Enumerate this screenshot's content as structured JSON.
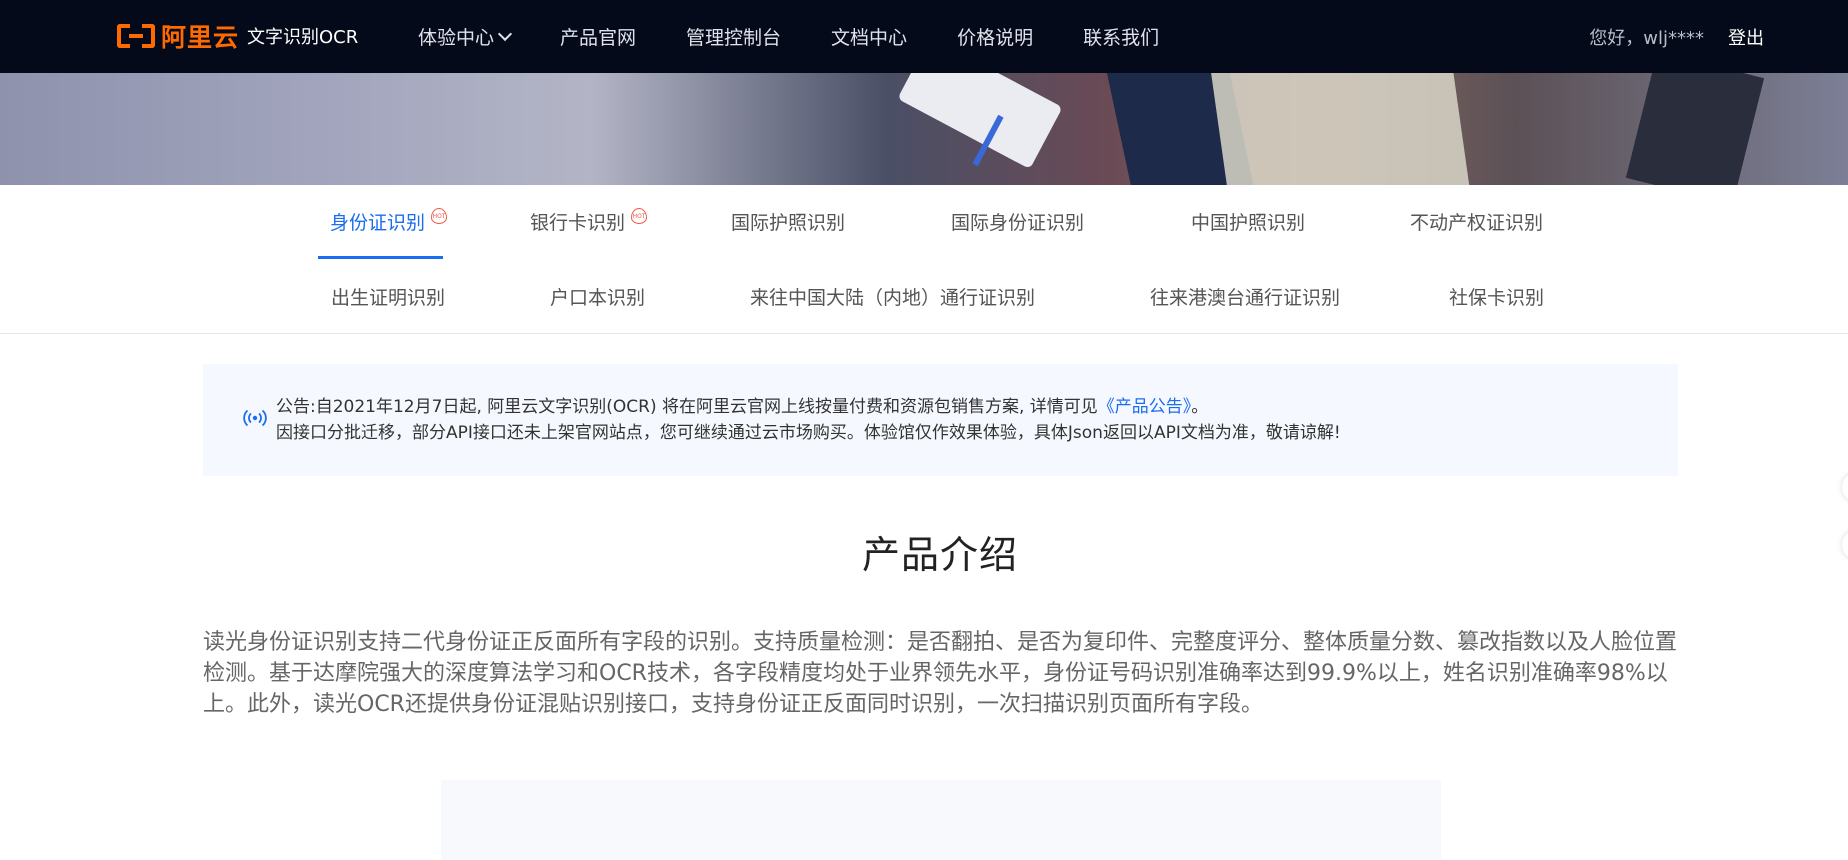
{
  "header": {
    "logo_brand": "阿里云",
    "logo_product": "文字识别OCR",
    "nav": [
      {
        "label": "体验中心",
        "has_dropdown": true
      },
      {
        "label": "产品官网"
      },
      {
        "label": "管理控制台"
      },
      {
        "label": "文档中心"
      },
      {
        "label": "价格说明"
      },
      {
        "label": "联系我们"
      }
    ],
    "greeting": "您好，wlj****",
    "logout": "登出"
  },
  "tabs": {
    "row1": [
      {
        "label": "身份证识别",
        "hot": true,
        "active": true
      },
      {
        "label": "银行卡识别",
        "hot": true
      },
      {
        "label": "国际护照识别"
      },
      {
        "label": "国际身份证识别"
      },
      {
        "label": "中国护照识别"
      },
      {
        "label": "不动产权证识别"
      }
    ],
    "row2": [
      {
        "label": "出生证明识别"
      },
      {
        "label": "户口本识别"
      },
      {
        "label": "来往中国大陆（内地）通行证识别"
      },
      {
        "label": "往来港澳台通行证识别"
      },
      {
        "label": "社保卡识别"
      }
    ],
    "hot_badge": "HOT"
  },
  "notice": {
    "line1_prefix": "公告:自2021年12月7日起, 阿里云文字识别(OCR) 将在阿里云官网上线按量付费和资源包销售方案, 详情可见",
    "line1_link": "《产品公告》",
    "line1_suffix": "。",
    "line2": "因接口分批迁移，部分API接口还未上架官网站点，您可继续通过云市场购买。体验馆仅作效果体验，具体Json返回以API文档为准，敬请谅解!"
  },
  "intro": {
    "title": "产品介绍",
    "text": "读光身份证识别支持二代身份证正反面所有字段的识别。支持质量检测：是否翻拍、是否为复印件、完整度评分、整体质量分数、篡改指数以及人脸位置检测。基于达摩院强大的深度算法学习和OCR技术，各字段精度均处于业界领先水平，身份证号码识别准确率达到99.9%以上，姓名识别准确率98%以上。此外，读光OCR还提供身份证混贴识别接口，支持身份证正反面同时识别，一次扫描识别页面所有字段。"
  },
  "colors": {
    "header_bg": "#050a1a",
    "brand_orange": "#ff6a00",
    "accent_blue": "#1a6cf0",
    "hot_red": "#f15a4b",
    "notice_bg": "#f5f9ff"
  }
}
